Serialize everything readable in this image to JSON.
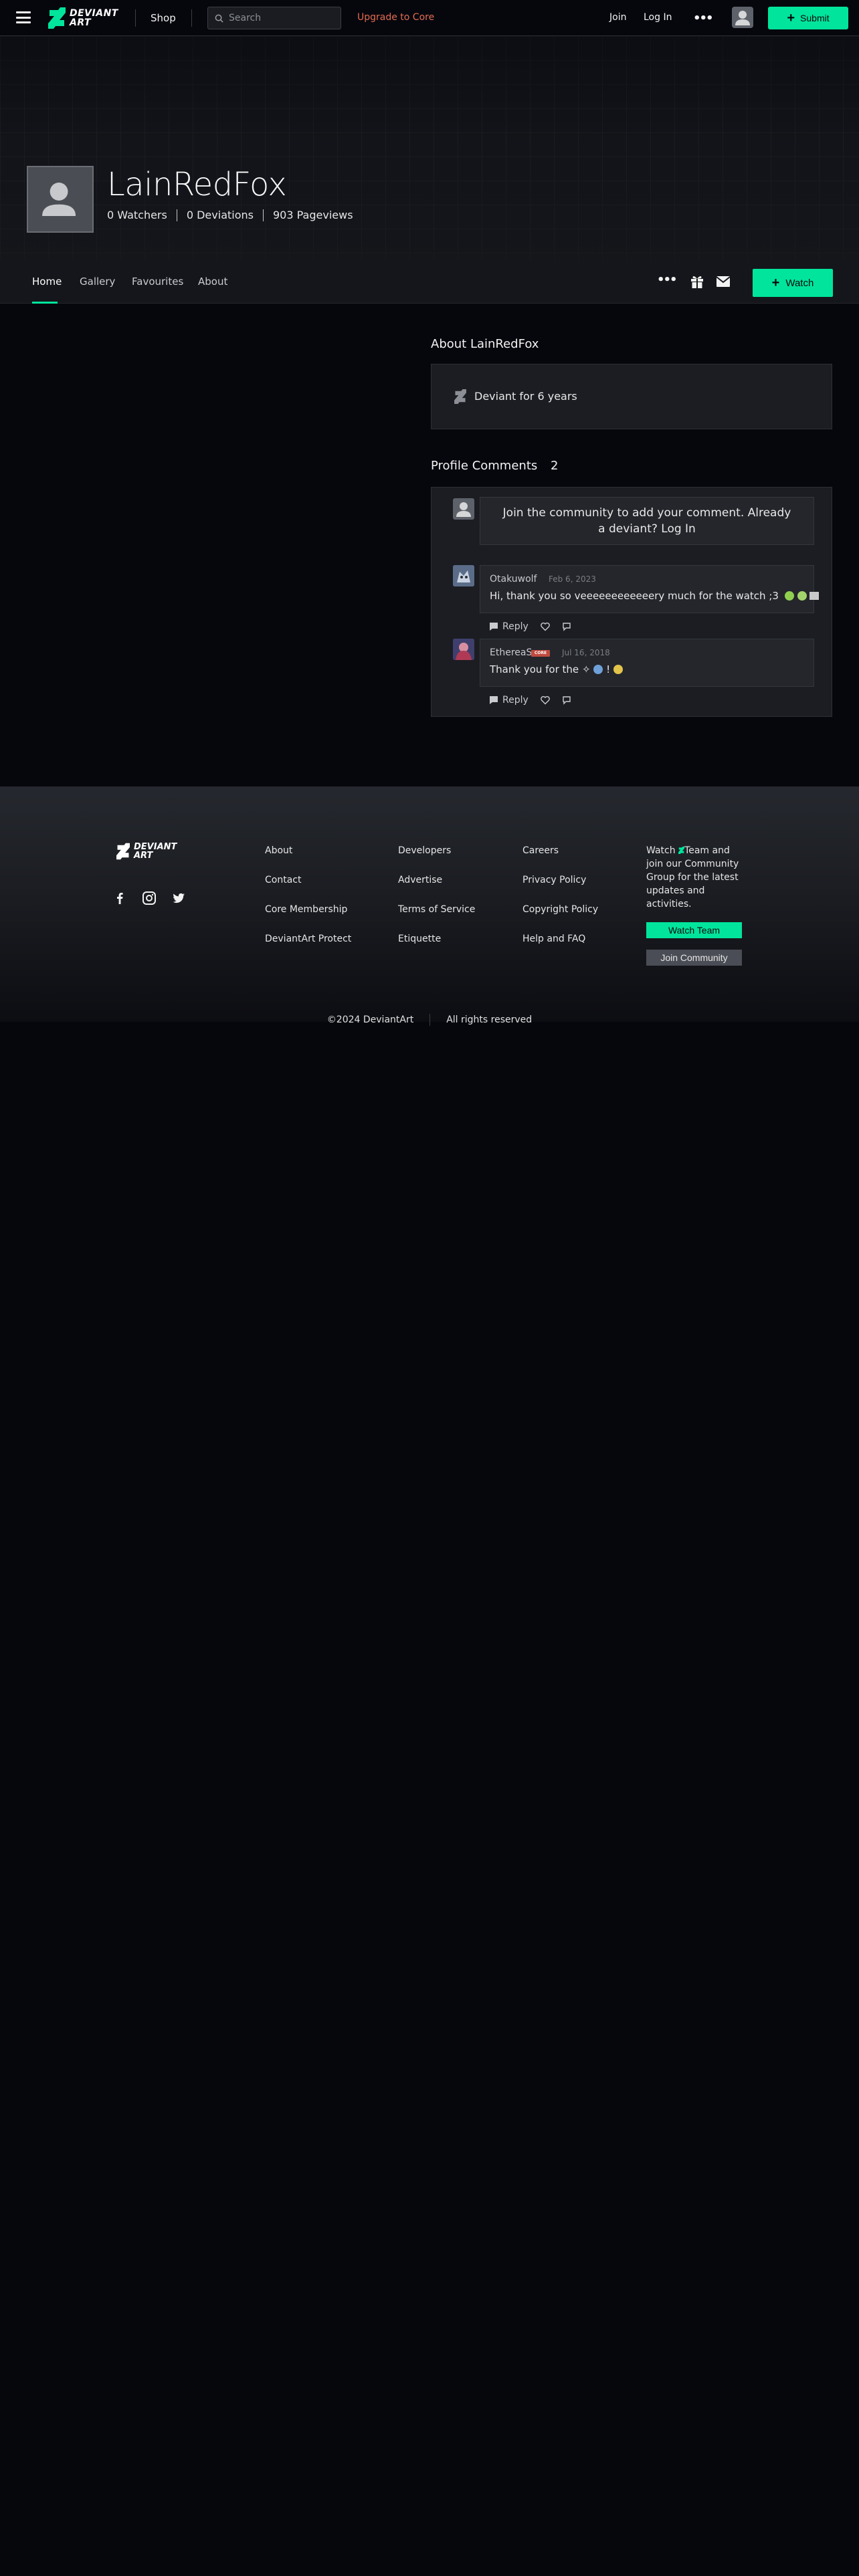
{
  "topbar": {
    "logo_text": [
      "DEVIANT",
      "ART"
    ],
    "shop_label": "Shop",
    "search_placeholder": "Search",
    "upgrade_label": "Upgrade to Core",
    "join_label": "Join",
    "login_label": "Log In",
    "more_label": "•••",
    "submit_label": "Submit"
  },
  "profile": {
    "username": "LainRedFox",
    "watchers": "0 Watchers",
    "deviations": "0 Deviations",
    "pageviews": "903 Pageviews"
  },
  "profile_nav": {
    "tabs": [
      "Home",
      "Gallery",
      "Favourites",
      "About"
    ],
    "active_tab": "Home",
    "more_label": "•••",
    "watch_label": "Watch"
  },
  "about": {
    "heading": "About LainRedFox",
    "since": "Deviant for 6 years"
  },
  "comments": {
    "heading": "Profile Comments",
    "count": "2",
    "join_prompt": "Join the community to add your comment. Already a deviant? Log In",
    "items": [
      {
        "author": "Otakuwolf",
        "date": "Feb 6, 2023",
        "text": "Hi, thank you so veeeeeeeeeeeery much for the watch ;3",
        "reply_label": "Reply"
      },
      {
        "author": "EthereaS",
        "badge": "CORE",
        "date": "Jul 16, 2018",
        "text": "Thank you for the",
        "text_after": "!",
        "reply_label": "Reply"
      }
    ]
  },
  "footer": {
    "logo_text": [
      "DEVIANT",
      "ART"
    ],
    "col1": [
      "About",
      "Contact",
      "Core Membership",
      "DeviantArt Protect"
    ],
    "col2": [
      "Developers",
      "Advertise",
      "Terms of Service",
      "Etiquette"
    ],
    "col3": [
      "Careers",
      "Privacy Policy",
      "Copyright Policy",
      "Help and FAQ"
    ],
    "watch_text_before": "Watch",
    "watch_text_after": "Team and join our Community Group for the latest updates and activities.",
    "watch_team_label": "Watch Team",
    "join_community_label": "Join Community",
    "copyright": "©2024 DeviantArt",
    "rights": "All rights reserved"
  },
  "colors": {
    "accent": "#00e59b",
    "upgrade": "#e46b4f",
    "background": "#06070d",
    "panel": "#1b1d22"
  }
}
